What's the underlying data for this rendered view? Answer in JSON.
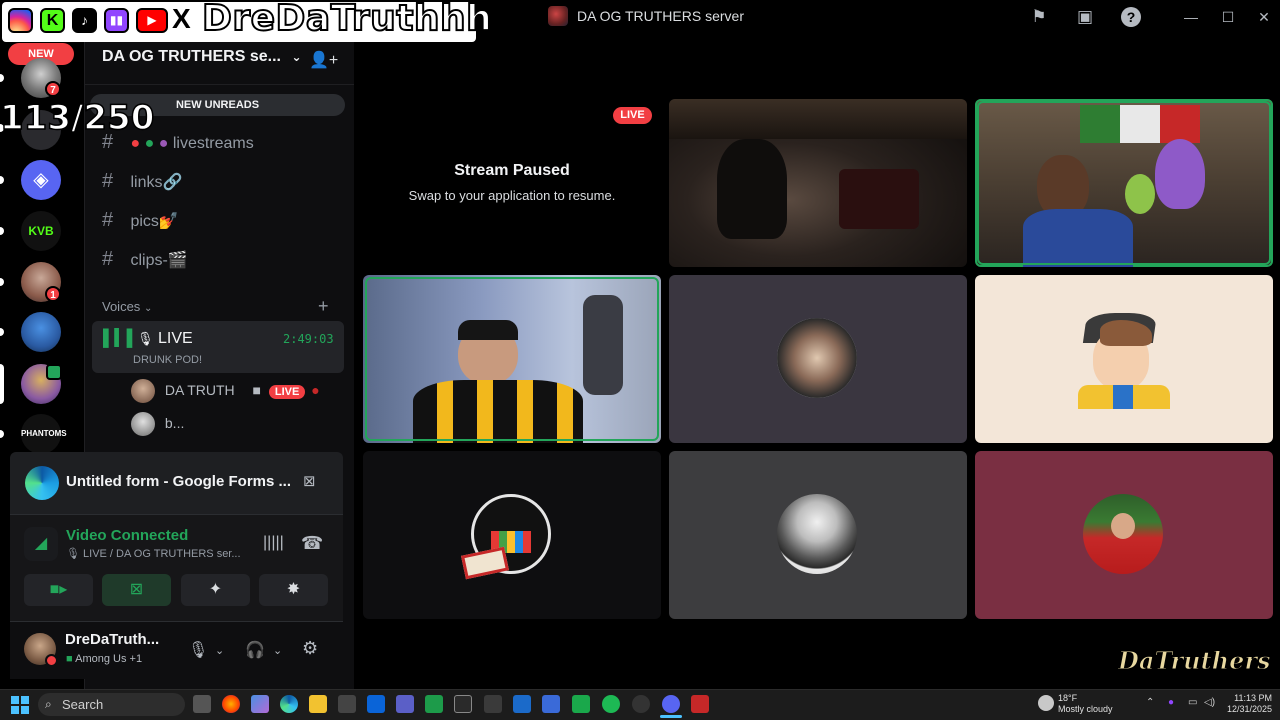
{
  "window": {
    "title": "DA OG TRUTHERS server",
    "controls": [
      "minimize-icon",
      "maximize-icon",
      "close-icon"
    ],
    "toolbar_icons": [
      "flag-icon",
      "inbox-icon",
      "help-icon"
    ]
  },
  "overlay": {
    "streamer_name": "DreDaTruthhh",
    "social_icons": [
      "instagram-icon",
      "kick-icon",
      "tiktok-icon",
      "twitch-icon",
      "youtube-icon",
      "x-icon"
    ],
    "counter": "113/250"
  },
  "server_rail": {
    "new_label": "NEW",
    "servers": [
      {
        "badge": "7"
      },
      {
        "badge": ""
      },
      {
        "badge": ""
      },
      {
        "badge": ""
      },
      {
        "badge": "1"
      },
      {
        "badge": ""
      },
      {
        "badge": ""
      },
      {
        "badge": ""
      }
    ]
  },
  "sidebar": {
    "server_name": "DA OG TRUTHERS se...",
    "new_unreads": "NEW UNREADS",
    "channels": [
      {
        "name": "livestreams"
      },
      {
        "name": "links🔗"
      },
      {
        "name": "pics💅"
      },
      {
        "name": "clips-🎬"
      }
    ],
    "voices_header": "Voices",
    "voice_channel": {
      "name": "LIVE",
      "timer": "2:49:03",
      "topic": "DRUNK POD!"
    },
    "voice_users": [
      {
        "name": "DA TRUTH",
        "live_badge": "LIVE"
      },
      {
        "name": "b..."
      }
    ]
  },
  "popup": {
    "title": "Untitled form - Google Forms ..."
  },
  "rtc": {
    "status": "Video Connected",
    "channel": "LIVE / DA OG TRUTHERS ser..."
  },
  "user": {
    "name": "DreDaTruth...",
    "activity": "Among Us +1"
  },
  "stage": {
    "stream_title": "Stream Paused",
    "stream_subtitle": "Swap to your application to resume.",
    "live_badge": "LIVE",
    "watermark": "DaTruthers",
    "tile_colors": [
      "#000000",
      "#3a3640",
      "#f3e6d8",
      "#0e0e10",
      "#3d3d3f",
      "#7a2f42"
    ]
  },
  "taskbar": {
    "search_placeholder": "Search",
    "weather_temp": "18°F",
    "weather_desc": "Mostly cloudy",
    "time": "11:13 PM",
    "date": "12/31/2025"
  }
}
